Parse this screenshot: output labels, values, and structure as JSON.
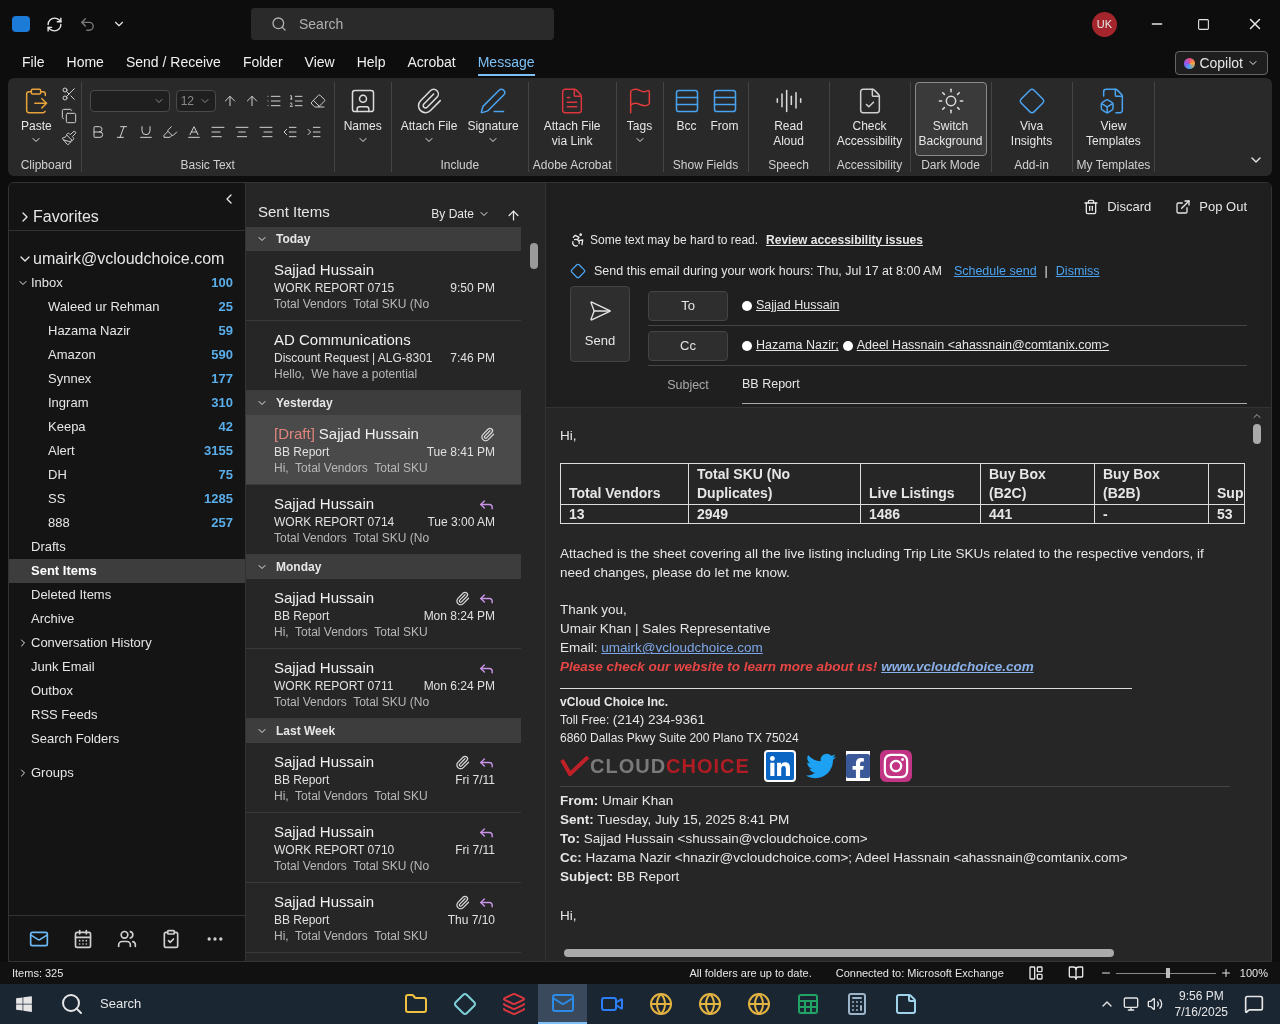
{
  "titlebar": {
    "search_placeholder": "Search",
    "avatar": "UK"
  },
  "menu_tabs": [
    {
      "label": "File",
      "selected": false
    },
    {
      "label": "Home",
      "selected": false
    },
    {
      "label": "Send / Receive",
      "selected": false
    },
    {
      "label": "Folder",
      "selected": false
    },
    {
      "label": "View",
      "selected": false
    },
    {
      "label": "Help",
      "selected": false
    },
    {
      "label": "Acrobat",
      "selected": false
    },
    {
      "label": "Message",
      "selected": true
    }
  ],
  "copilot": "Copilot",
  "ribbon": [
    {
      "kind": "clipboard",
      "label": "Clipboard",
      "buttons": [
        {
          "kind": "paste",
          "label": "Paste",
          "menu": true,
          "selected": false
        }
      ]
    },
    {
      "kind": "format",
      "label": "Basic Text",
      "font_size": "12"
    },
    {
      "kind": "buttons",
      "buttons": [
        {
          "kind": "names",
          "label": "Names",
          "menu": true,
          "selected": false
        }
      ]
    },
    {
      "kind": "buttons",
      "label": "Include",
      "buttons": [
        {
          "kind": "attach",
          "label": "Attach File",
          "menu": true,
          "selected": false
        },
        {
          "kind": "signature",
          "label": "Signature",
          "menu": true,
          "selected": false
        }
      ]
    },
    {
      "kind": "buttons",
      "label": "Adobe Acrobat",
      "buttons": [
        {
          "kind": "pdf",
          "label": "Attach File via Link",
          "menu": false,
          "selected": false
        }
      ]
    },
    {
      "kind": "buttons",
      "buttons": [
        {
          "kind": "flag",
          "label": "Tags",
          "menu": true,
          "selected": false
        }
      ]
    },
    {
      "kind": "buttons",
      "label": "Show Fields",
      "buttons": [
        {
          "kind": "bcc",
          "label": "Bcc",
          "menu": false,
          "selected": false
        },
        {
          "kind": "from",
          "label": "From",
          "menu": false,
          "selected": false
        }
      ]
    },
    {
      "kind": "buttons",
      "label": "Speech",
      "buttons": [
        {
          "kind": "read",
          "label": "Read Aloud",
          "menu": false,
          "selected": false
        }
      ]
    },
    {
      "kind": "buttons",
      "label": "Accessibility",
      "buttons": [
        {
          "kind": "check",
          "label": "Check Accessibility",
          "menu": false,
          "selected": false
        }
      ]
    },
    {
      "kind": "buttons",
      "label": "Dark Mode",
      "buttons": [
        {
          "kind": "sun",
          "label": "Switch Background",
          "menu": false,
          "selected": true
        }
      ]
    },
    {
      "kind": "buttons",
      "label": "Add-in",
      "buttons": [
        {
          "kind": "viva",
          "label": "Viva Insights",
          "menu": false,
          "selected": false
        }
      ]
    },
    {
      "kind": "buttons",
      "label": "My Templates",
      "buttons": [
        {
          "kind": "templates",
          "label": "View Templates",
          "menu": false,
          "selected": false
        }
      ]
    }
  ],
  "favorites": {
    "label": "Favorites",
    "expanded": false
  },
  "account": {
    "label": "umairk@vcloudchoice.com",
    "expanded": true,
    "folders": [
      {
        "label": "Inbox",
        "count": "100",
        "expanded": true,
        "selected": false,
        "children": [
          {
            "label": "Waleed ur Rehman",
            "count": "25",
            "selected": false
          },
          {
            "label": "Hazama Nazir",
            "count": "59",
            "selected": false
          },
          {
            "label": "Amazon",
            "count": "590",
            "selected": false
          },
          {
            "label": "Synnex",
            "count": "177",
            "selected": false
          },
          {
            "label": "Ingram",
            "count": "310",
            "selected": false
          },
          {
            "label": "Keepa",
            "count": "42",
            "selected": false
          },
          {
            "label": "Alert",
            "count": "3155",
            "selected": false
          },
          {
            "label": "DH",
            "count": "75",
            "selected": false
          },
          {
            "label": "SS",
            "count": "1285",
            "selected": false
          },
          {
            "label": "888",
            "count": "257",
            "selected": false
          }
        ]
      },
      {
        "label": "Drafts",
        "selected": false
      },
      {
        "label": "Sent Items",
        "selected": true
      },
      {
        "label": "Deleted Items",
        "selected": false
      },
      {
        "label": "Archive",
        "selected": false
      },
      {
        "label": "Conversation History",
        "expanded": false,
        "selected": false
      },
      {
        "label": "Junk Email",
        "selected": false
      },
      {
        "label": "Outbox",
        "selected": false
      },
      {
        "label": "RSS Feeds",
        "selected": false
      },
      {
        "label": "Search Folders",
        "selected": false
      }
    ]
  },
  "groups_section": {
    "label": "Groups",
    "expanded": false
  },
  "nav": [
    {
      "kind": "mail",
      "selected": true
    },
    {
      "kind": "calendar",
      "selected": false
    },
    {
      "kind": "people",
      "selected": false
    },
    {
      "kind": "tasks",
      "selected": false
    },
    {
      "kind": "more",
      "selected": false
    }
  ],
  "message_list": {
    "title": "Sent Items",
    "sort": "By Date",
    "groups": [
      {
        "label": "Today",
        "expanded": true,
        "messages": [
          {
            "sender": "Sajjad Hussain",
            "subject": "WORK REPORT 0715",
            "preview": "Total Vendors  Total SKU (No",
            "time": "9:50 PM",
            "attachment": false,
            "replied": false,
            "selected": false
          },
          {
            "sender": "AD Communications",
            "subject": "Discount Request | ALG-8301",
            "preview": "Hello,  We have a potential",
            "time": "7:46 PM",
            "attachment": false,
            "replied": false,
            "selected": false
          }
        ]
      },
      {
        "label": "Yesterday",
        "expanded": true,
        "messages": [
          {
            "tag": "[Draft]",
            "sender": "Sajjad Hussain",
            "subject": "BB Report",
            "preview": "Hi,  Total Vendors  Total SKU",
            "time": "Tue 8:41 PM",
            "attachment": true,
            "replied": false,
            "selected": true
          },
          {
            "sender": "Sajjad Hussain",
            "subject": "WORK REPORT 0714",
            "preview": "Total Vendors  Total SKU (No",
            "time": "Tue 3:00 AM",
            "attachment": false,
            "replied": true,
            "selected": false
          }
        ]
      },
      {
        "label": "Monday",
        "expanded": true,
        "messages": [
          {
            "sender": "Sajjad Hussain",
            "subject": "BB Report",
            "preview": "Hi,  Total Vendors  Total SKU",
            "time": "Mon 8:24 PM",
            "attachment": true,
            "replied": true,
            "selected": false
          },
          {
            "sender": "Sajjad Hussain",
            "subject": "WORK REPORT 0711",
            "preview": "Total Vendors  Total SKU (No",
            "time": "Mon 6:24 PM",
            "attachment": false,
            "replied": true,
            "selected": false
          }
        ]
      },
      {
        "label": "Last Week",
        "expanded": true,
        "messages": [
          {
            "sender": "Sajjad Hussain",
            "subject": "BB Report",
            "preview": "Hi,  Total Vendors  Total SKU",
            "time": "Fri 7/11",
            "attachment": true,
            "replied": true,
            "selected": false
          },
          {
            "sender": "Sajjad Hussain",
            "subject": "WORK REPORT 0710",
            "preview": "Total Vendors  Total SKU (No",
            "time": "Fri 7/11",
            "attachment": false,
            "replied": true,
            "selected": false
          },
          {
            "sender": "Sajjad Hussain",
            "subject": "BB Report",
            "preview": "Hi,  Total Vendors  Total SKU",
            "time": "Thu 7/10",
            "attachment": true,
            "replied": true,
            "selected": false
          }
        ]
      }
    ]
  },
  "compose": {
    "discard": "Discard",
    "pop_out": "Pop Out",
    "accessibility": {
      "text": "Some text may be hard to read.",
      "link": "Review accessibility issues"
    },
    "schedule": {
      "text": "Send this email during your work hours: Thu, Jul 17 at 8:00 AM",
      "link": "Schedule send",
      "separator": "|",
      "dismiss": "Dismiss"
    },
    "send": "Send",
    "to_button": "To",
    "to": [
      "Sajjad Hussain"
    ],
    "cc_button": "Cc",
    "cc": [
      "Hazama Nazir;",
      "Adeel Hassnain <ahassnain@comtanix.com>"
    ],
    "subject_label": "Subject",
    "subject": "BB Report"
  },
  "body": {
    "greeting": "Hi,",
    "table": {
      "columns": [
        "Total Vendors",
        "Total SKU (No Duplicates)",
        "Live Listings",
        "Buy Box (B2C)",
        "Buy Box (B2B)",
        "Sup"
      ],
      "rows": [
        [
          "13",
          "2949",
          "1486",
          "441",
          "-",
          "53"
        ]
      ]
    },
    "paragraph": "Attached is the sheet covering all the live listing including Trip Lite SKUs related to the respective vendors, if need changes, please do let me know.",
    "closing": [
      "Thank you,",
      "Umair Khan | Sales Representative"
    ],
    "email_label": "Email:",
    "email": "umairk@vcloudchoice.com",
    "promo": "Please check our website to learn more about us!",
    "website": "www.vcloudchoice.com",
    "company": "vCloud Choice Inc.",
    "toll_label": "Toll Free:",
    "toll": "(214) 234-9361",
    "address": "6860 Dallas Pkwy Suite 200 Plano TX 75024",
    "logo_text": "CLOUDCHOICE",
    "forward": [
      "**From:** Umair Khan",
      "**Sent:** Tuesday, July 15, 2025 8:41 PM",
      "**To:** Sajjad Hussain <shussain@vcloudchoice.com>",
      "**Cc:** Hazama Nazir <hnazir@vcloudchoice.com>; Adeel Hassnain <ahassnain@comtanix.com>",
      "**Subject:** BB Report"
    ],
    "greeting2": "Hi,"
  },
  "status_bar": {
    "items": "Items: 325",
    "sync": "All folders are up to date.",
    "connection": "Connected to: Microsoft Exchange",
    "zoom": "100%",
    "level": 0.5
  },
  "taskbar": {
    "search": "Search",
    "apps": [
      {
        "kind": "folder",
        "selected": false
      },
      {
        "kind": "diamond",
        "selected": false
      },
      {
        "kind": "ftp",
        "selected": false
      },
      {
        "kind": "mail",
        "selected": true
      },
      {
        "kind": "video",
        "selected": false
      },
      {
        "kind": "browser",
        "selected": false
      },
      {
        "kind": "browser",
        "selected": false
      },
      {
        "kind": "browser",
        "selected": false
      },
      {
        "kind": "sheet",
        "selected": false
      },
      {
        "kind": "calculator",
        "selected": false
      },
      {
        "kind": "note",
        "selected": false
      }
    ],
    "time": "9:56 PM",
    "date": "7/16/2025"
  }
}
